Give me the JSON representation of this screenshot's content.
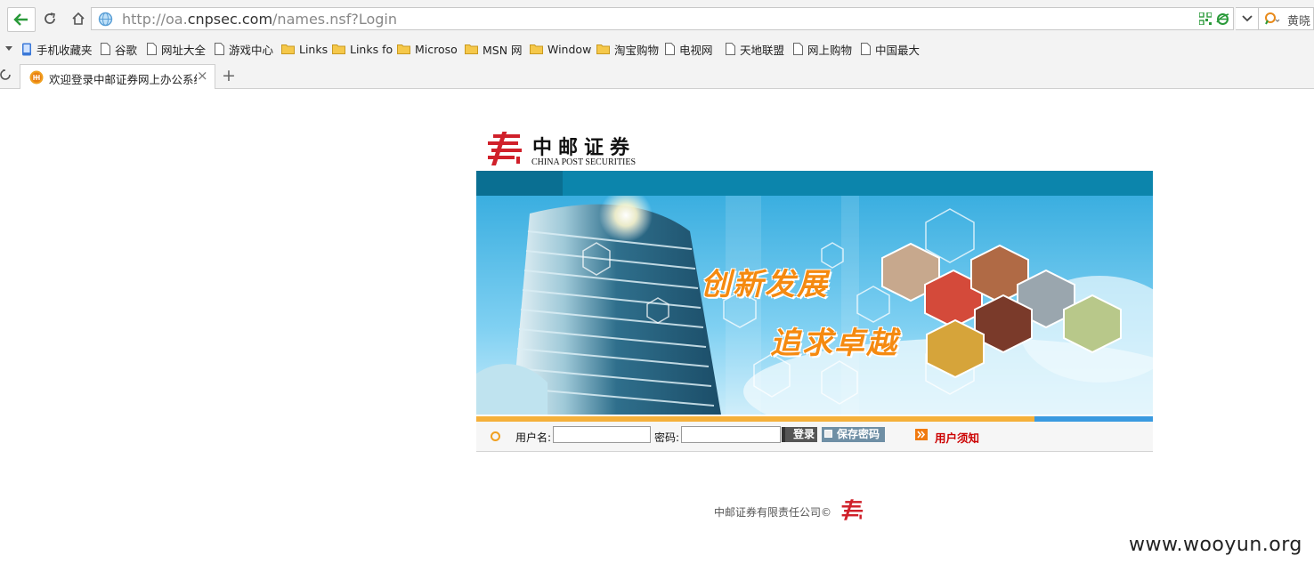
{
  "browser": {
    "url_prefix": "http://oa.",
    "url_domain": "cnpsec.com",
    "url_path": "/names.nsf?Login",
    "search_text": "黄晓",
    "bookmarks": [
      "手机收藏夹",
      "谷歌",
      "网址大全",
      "游戏中心",
      "Links",
      "Links fo",
      "Microso",
      "MSN 网",
      "Window",
      "淘宝购物",
      "电视网",
      "天地联盟",
      "网上购物",
      "中国最大"
    ],
    "tab_title": "欢迎登录中邮证券网上办公系统",
    "tab_close": "×",
    "new_tab": "+"
  },
  "page": {
    "logo_cn": "中邮证券",
    "logo_en": "CHINA POST SECURITIES",
    "slogan_line1": "创新发展",
    "slogan_line2": "追求卓越",
    "login": {
      "username_label": "用户名:",
      "password_label": "密码:",
      "login_button": "登录",
      "save_password": "保存密码",
      "notice_link": "用户须知"
    },
    "footer": "中邮证券有限责任公司©",
    "watermark": "www.wooyun.org"
  },
  "colors": {
    "brand_red": "#d0202a",
    "banner_blue": "#0c85ac",
    "slogan_orange": "#f58a10",
    "notice_red": "#cc0000"
  }
}
